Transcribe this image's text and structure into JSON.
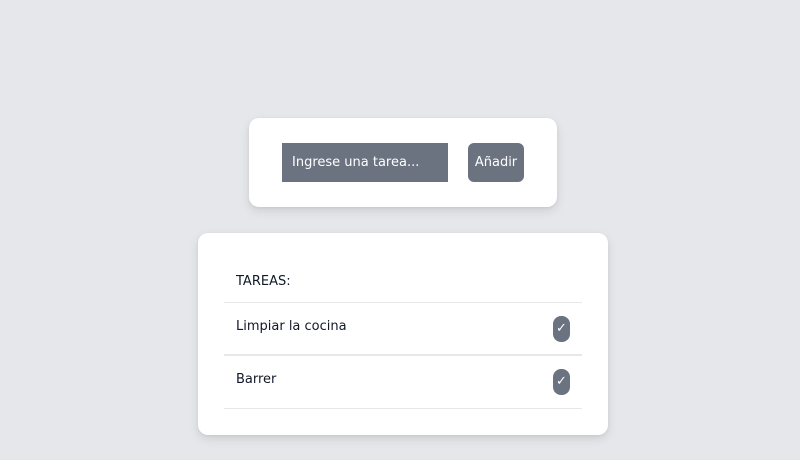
{
  "form": {
    "input_placeholder": "Ingrese una tarea...",
    "input_value": "",
    "add_label": "Añadir"
  },
  "tasks": {
    "header": "TAREAS:",
    "items": [
      {
        "label": "Limpiar la cocina",
        "check_icon": "✓"
      },
      {
        "label": "Barrer",
        "check_icon": "✓"
      }
    ]
  },
  "colors": {
    "background": "#e5e7eb",
    "card": "#ffffff",
    "accent": "#6b7280",
    "text": "#111827"
  }
}
